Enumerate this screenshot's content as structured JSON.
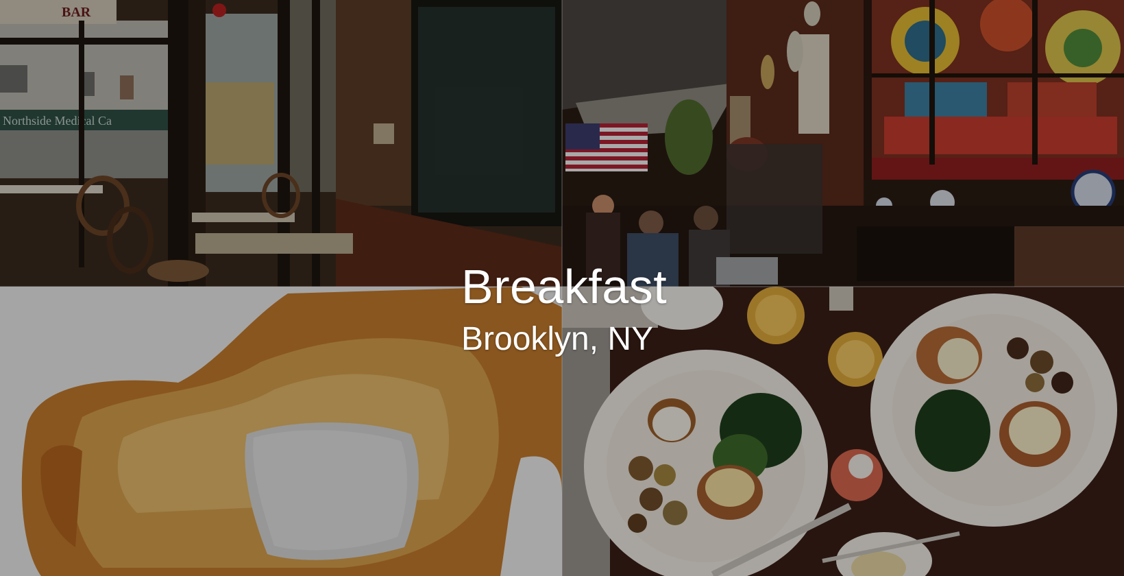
{
  "hero": {
    "title": "Breakfast",
    "subtitle": "Brooklyn, NY"
  },
  "photos": [
    {
      "id": "restaurant-interior-windows",
      "visible_text": [
        "BAR",
        "Northside Medical Ca"
      ]
    },
    {
      "id": "restaurant-interior-stained-glass"
    },
    {
      "id": "donut-closeup"
    },
    {
      "id": "eggs-benedict-plates"
    }
  ]
}
